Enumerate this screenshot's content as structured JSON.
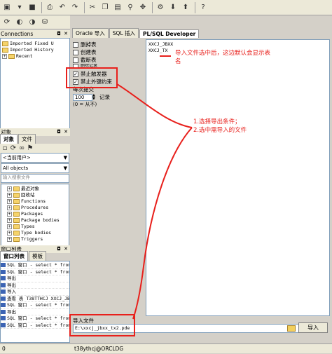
{
  "toolbar": {
    "icons": [
      "new-icon",
      "open-icon",
      "save-icon",
      "print-icon",
      "undo-icon",
      "redo-icon",
      "cut-icon",
      "copy-icon",
      "paste-icon",
      "find-icon",
      "goto-icon",
      "execute-icon",
      "commit-icon",
      "rollback-icon",
      "help-icon"
    ]
  },
  "connections_panel": {
    "title": "Connections",
    "items": [
      {
        "label": "Imported Fixed U"
      },
      {
        "label": "Imported History"
      },
      {
        "label": "Recent"
      }
    ]
  },
  "objects_panel": {
    "title": "对象",
    "tabs": [
      "对象",
      "文件"
    ],
    "user_select": "<当前用户>",
    "filter_select": "All objects",
    "search_placeholder": "输入搜索文件",
    "items": [
      "最近对象",
      "回收站",
      "Functions",
      "Procedures",
      "Packages",
      "Package bodies",
      "Types",
      "Type bodies",
      "Triggers"
    ]
  },
  "window_list": {
    "title": "窗口列表",
    "tabs": [
      "窗口列表",
      "模板"
    ],
    "items": [
      "SQL 窗口 - select * from",
      "SQL 窗口 - select * from",
      "导出",
      "导出",
      "导入",
      "查看 表 T38TTHCJ XXCJ_JB",
      "SQL 窗口 - select * from",
      "导出",
      "SQL 窗口 - select * from",
      "SQL 窗口 - select * from"
    ]
  },
  "tabs": [
    "Oracle 导入",
    "SQL 插入",
    "PL/SQL Developer"
  ],
  "options": {
    "drop_tables": "删掉表",
    "create_tables": "创建表",
    "truncate_tables": "截断表",
    "disable_triggers": "禁止触发器",
    "disable_fk": "禁止外键约束",
    "commit_every_label": "每次提交",
    "commit_value": "100",
    "commit_unit": "记录",
    "commit_hint": "(0 = 从不)",
    "cut_label": "删除记录"
  },
  "tables_list": [
    "XXCJ_JBXX",
    "XXCJ_TX"
  ],
  "import_file": {
    "label": "导入文件",
    "value": "E:\\xxcj_jbxx_tx2.pde",
    "button": "导入"
  },
  "annotations": {
    "top_right": "导入文件选中后，这边默认会显示表名",
    "middle": "1.选择导出条件；\n2.选中需导入的文件"
  },
  "statusbar": {
    "left": "0",
    "connection": "t38ythcj@ORCLDG"
  },
  "colors": {
    "annotation_red": "#e8201c",
    "panel_bg": "#d4d0c8",
    "toolbar_bg": "#ece9d8"
  }
}
